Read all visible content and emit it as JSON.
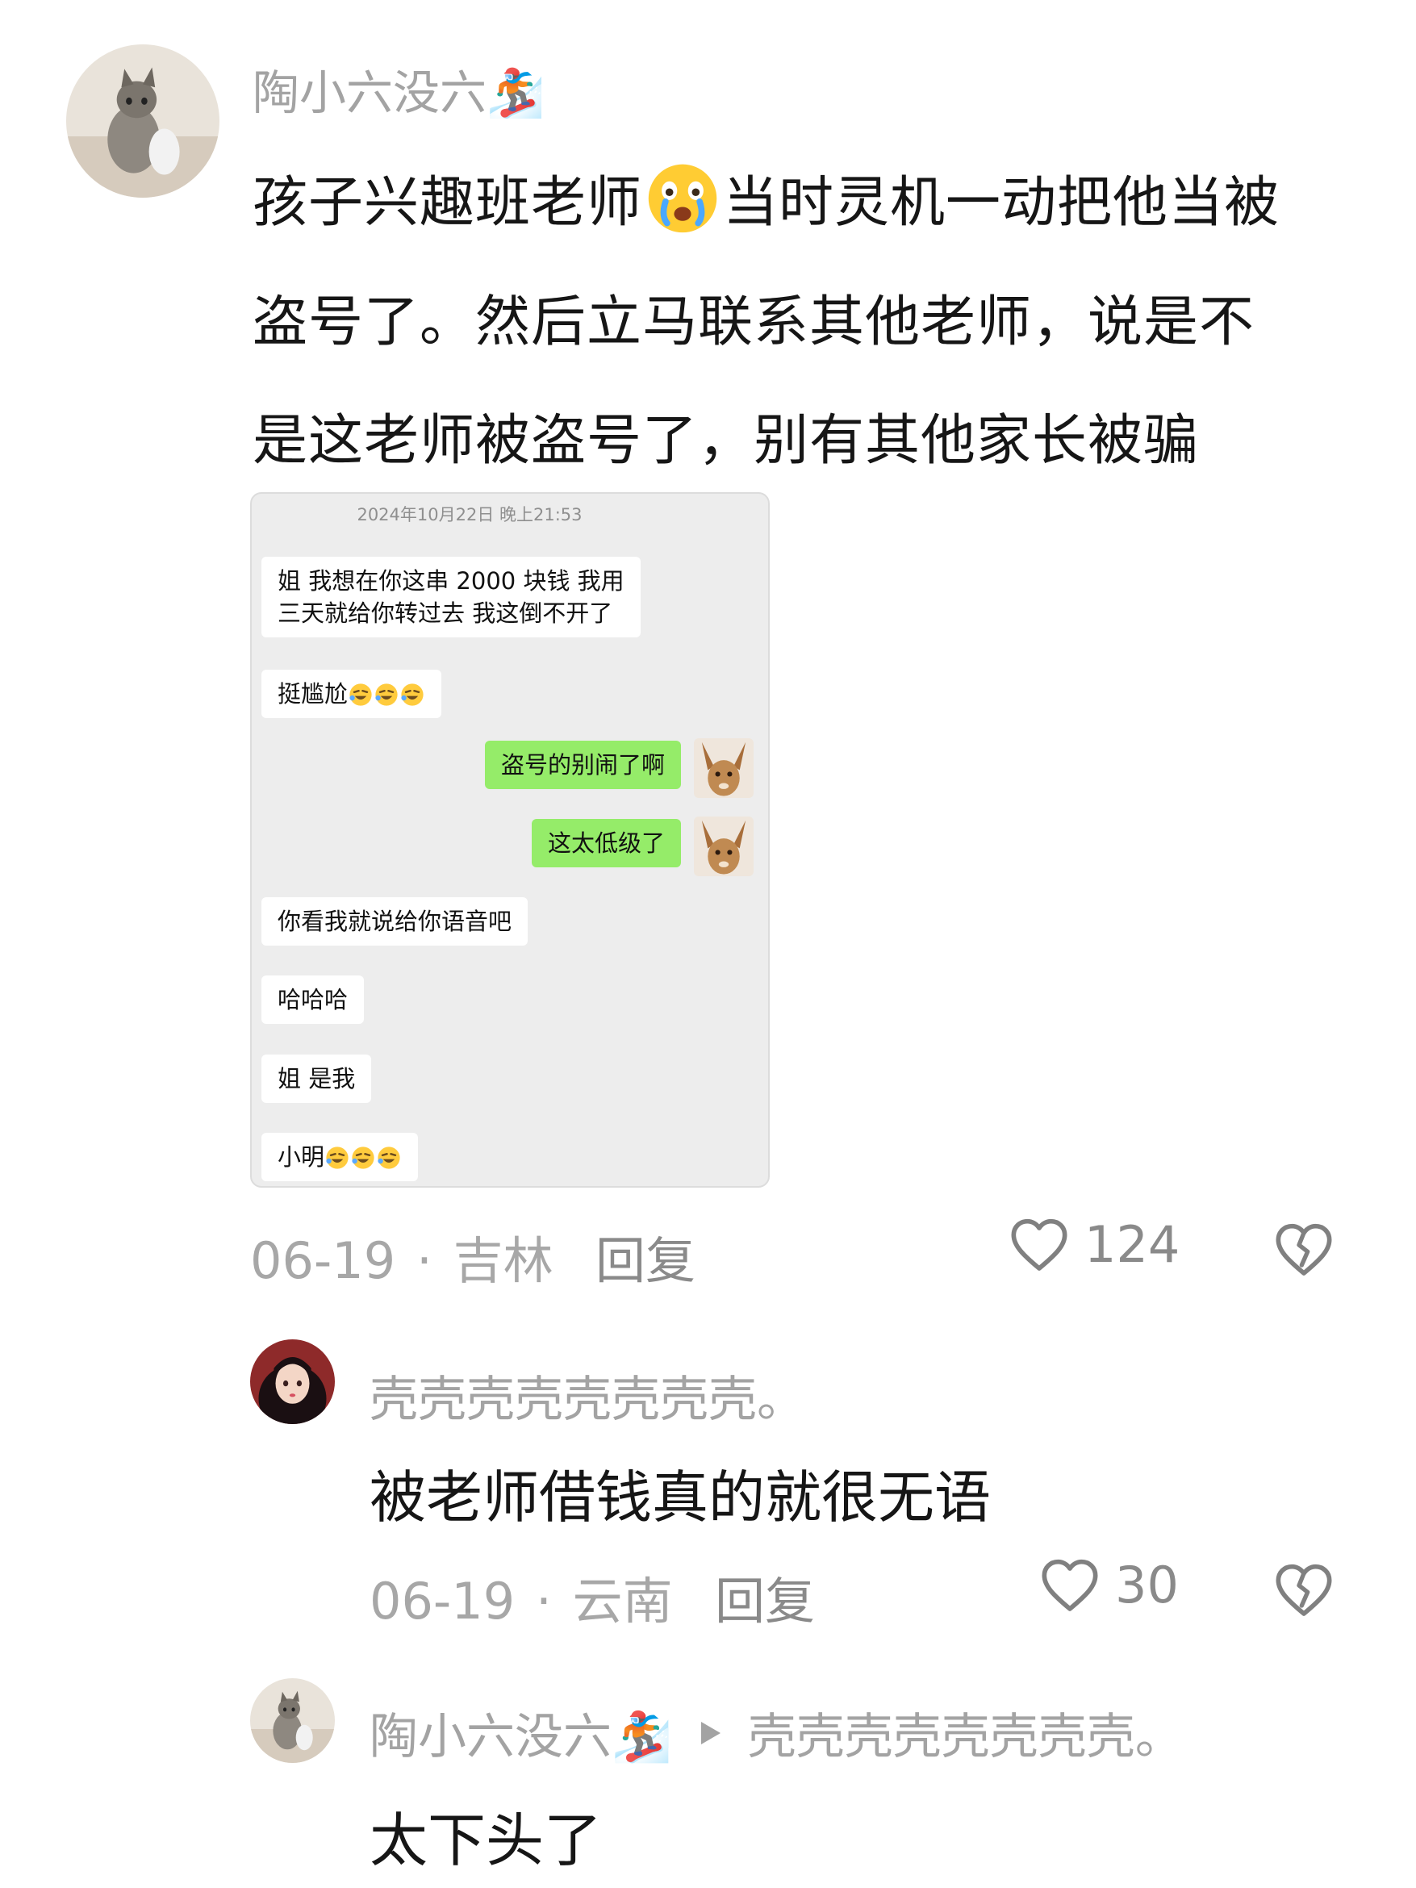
{
  "main_comment": {
    "username": "陶小六没六🏂",
    "text_lines": [
      {
        "before": "孩子兴趣班老师",
        "after": "当时灵机一动把他当被"
      },
      "盗号了。然后立马联系其他老师，说是不",
      "是这老师被盗号了，别有其他家长被骗"
    ],
    "date": "06-19",
    "location": "吉林",
    "reply_label": "回复",
    "like_count": "124"
  },
  "screenshot": {
    "timestamp": "2024年10月22日 晚上21:53",
    "messages": [
      {
        "side": "left",
        "lines": [
          "姐 我想在你这串 2000 块钱 我用",
          "三天就给你转过去 我这倒不开了"
        ]
      },
      {
        "side": "left",
        "text": "挺尴尬",
        "emoji_count": 3
      },
      {
        "side": "right",
        "text": "盗号的别闹了啊"
      },
      {
        "side": "right",
        "text": "这太低级了"
      },
      {
        "side": "left",
        "text": "你看我就说给你语音吧"
      },
      {
        "side": "left",
        "text": "哈哈哈"
      },
      {
        "side": "left",
        "text": "姐 是我"
      },
      {
        "side": "left",
        "text": "小明",
        "emoji_count": 3
      }
    ]
  },
  "reply_1": {
    "username": "壳壳壳壳壳壳壳壳。",
    "text": "被老师借钱真的就很无语",
    "date": "06-19",
    "location": "云南",
    "reply_label": "回复",
    "like_count": "30"
  },
  "reply_2": {
    "username": "陶小六没六🏂",
    "reply_to": "壳壳壳壳壳壳壳壳。",
    "text": "太下头了"
  },
  "icons": {
    "like": "heart-outline-icon",
    "dislike": "broken-heart-icon",
    "reply_arrow": "play-triangle-icon"
  },
  "colors": {
    "bubble_self": "#95ec69",
    "bubble_other": "#ffffff",
    "chat_background": "#ededed",
    "secondary_text": "#a3a3a3"
  }
}
